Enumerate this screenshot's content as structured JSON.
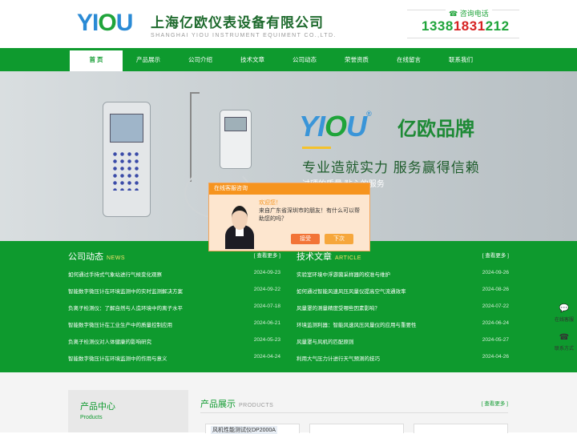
{
  "header": {
    "logo_text_1": "YI",
    "logo_text_o": "O",
    "logo_text_2": "U",
    "company_cn": "上海亿欧仪表设备有限公司",
    "company_en": "SHANGHAI YIOU INSTRUMENT EQUIMENT CO.,LTD.",
    "hotline_label": "咨询电话",
    "hotline_number_1": "1338",
    "hotline_number_2": "1831",
    "hotline_number_3": "212"
  },
  "nav": {
    "items": [
      {
        "label": "首 页"
      },
      {
        "label": "产品展示"
      },
      {
        "label": "公司介绍"
      },
      {
        "label": "技术文章"
      },
      {
        "label": "公司动态"
      },
      {
        "label": "荣誉资质"
      },
      {
        "label": "在线留言"
      },
      {
        "label": "联系我们"
      }
    ]
  },
  "banner": {
    "brand_1": "YI",
    "brand_o": "O",
    "brand_2": "U",
    "brand_cn": "亿欧品牌",
    "slogan": "专业造就实力 服务赢得信赖",
    "subslogan": "过硬的质量 贴心的服务"
  },
  "chat": {
    "title": "在线客服咨询",
    "greeting": "欢迎您！",
    "message": "来自广东省深圳市的朋友！有什么可以帮助您的吗？",
    "accept_label": "接受",
    "later_label": "下次"
  },
  "news": {
    "company": {
      "title": "公司动态",
      "title_en": "NEWS",
      "more": "[ 查看更多 ]",
      "items": [
        {
          "title": "如何通过手持式气象站进行气候变化观察",
          "date": "2024-09-23"
        },
        {
          "title": "智能数字微压计在环境监测中的实时监测解决方案",
          "date": "2024-09-22"
        },
        {
          "title": "负离子检测仪：了解自然与人造环境中的离子水平",
          "date": "2024-07-18"
        },
        {
          "title": "智能数字微压计在工业生产中的质量控制应用",
          "date": "2024-06-21"
        },
        {
          "title": "负离子检测仪对人体健康的影响研究",
          "date": "2024-05-23"
        },
        {
          "title": "智能数字微压计在环境监测中的作用与意义",
          "date": "2024-04-24"
        }
      ]
    },
    "tech": {
      "title": "技术文章",
      "title_en": "ARTICLE",
      "more": "[ 查看更多 ]",
      "items": [
        {
          "title": "实验室环境中浮游菌采样器的校准与维护",
          "date": "2024-09-26"
        },
        {
          "title": "如何通过智能风速风压风量仪提高空气流通效率",
          "date": "2024-08-26"
        },
        {
          "title": "风量罩的测量精度受哪些因素影响？",
          "date": "2024-07-22"
        },
        {
          "title": "环境监测利器：智能风速风压风量仪的应用与重要性",
          "date": "2024-06-24"
        },
        {
          "title": "风量罩与风机的匹配原则",
          "date": "2024-05-27"
        },
        {
          "title": "利用大气压力计进行天气预测的技巧",
          "date": "2024-04-26"
        }
      ]
    }
  },
  "products": {
    "center_title": "产品中心",
    "center_sub": "Products",
    "title": "产品展示",
    "title_en": "PRODUCTS",
    "more": "[ 查看更多 ]",
    "first_card_caption": "风机性能测试仪DP2000A"
  },
  "side_tools": [
    {
      "label": "在线客服",
      "icon": "chat-icon"
    },
    {
      "label": "联系方式",
      "icon": "phone-icon"
    }
  ],
  "colors": {
    "primary_green": "#0e9a2e",
    "brand_blue": "#2a8ad5",
    "accent_orange": "#f6941e",
    "accent_red": "#d62222"
  }
}
